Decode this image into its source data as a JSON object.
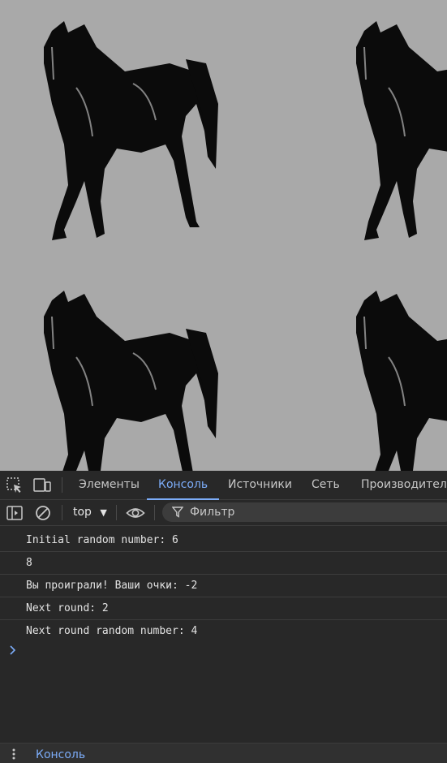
{
  "devtools": {
    "tabs": [
      "Элементы",
      "Консоль",
      "Источники",
      "Сеть",
      "Производитель"
    ],
    "active_tab": "Консоль",
    "toolbar": {
      "context": "top",
      "filter_placeholder": "Фильтр"
    },
    "console_lines": [
      "Initial random number: 6",
      "8",
      "Вы проиграли! Ваши очки: -2",
      "Next round: 2",
      "Next round random number: 4"
    ],
    "drawer_tab": "Консоль"
  },
  "colors": {
    "page_background": "#a9a9a9",
    "devtools_background": "#282828",
    "accent": "#7cacf8"
  },
  "icons": [
    "inspect-element-icon",
    "device-toolbar-icon",
    "sidebar-toggle-icon",
    "clear-console-icon",
    "dropdown-arrow-icon",
    "eye-icon",
    "filter-icon",
    "console-prompt-icon",
    "more-vertical-icon",
    "horse-image"
  ]
}
